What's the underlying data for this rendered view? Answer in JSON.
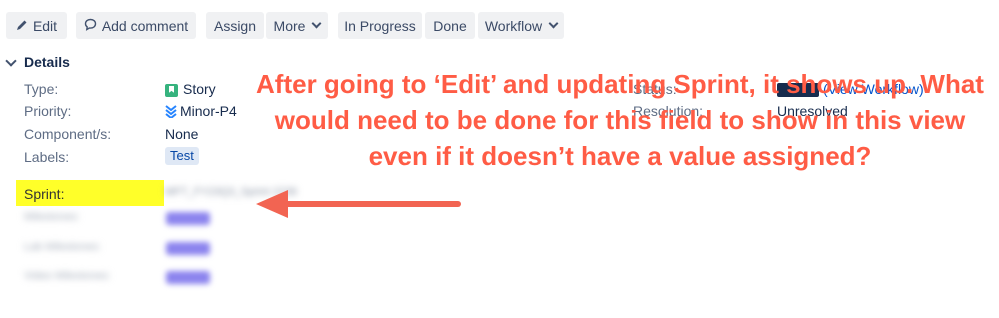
{
  "toolbar": {
    "edit": "Edit",
    "add_comment": "Add comment",
    "assign": "Assign",
    "more": "More",
    "in_progress": "In Progress",
    "done": "Done",
    "workflow": "Workflow"
  },
  "details": {
    "title": "Details",
    "fields": {
      "type_label": "Type:",
      "type_value": "Story",
      "priority_label": "Priority:",
      "priority_value": "Minor-P4",
      "components_label": "Component/s:",
      "components_value": "None",
      "labels_label": "Labels:",
      "labels_value": "Test",
      "sprint_label": "Sprint:",
      "sprint_value": "MFT_FY23Q3_Sprint 2236",
      "milestones_label": "Milestones:",
      "lab_milestones_label": "Lab Milestones:",
      "video_milestones_label": "Video Milestones:"
    },
    "right": {
      "status_label": "Status:",
      "status_value": "(View Workflow)",
      "resolution_label": "Resolution:",
      "resolution_value": "Unresolved"
    }
  },
  "annotation": {
    "text": "After going to ‘Edit’ and updating Sprint, it shows up. What would need to be done for this field to show in this view even if it doesn’t have a value assigned?"
  },
  "colors": {
    "annotation": "#ff5c45",
    "highlight": "#ffff29",
    "button_bg": "#f0f1f3",
    "story_icon": "#36b37e",
    "priority_icon": "#2684ff"
  }
}
